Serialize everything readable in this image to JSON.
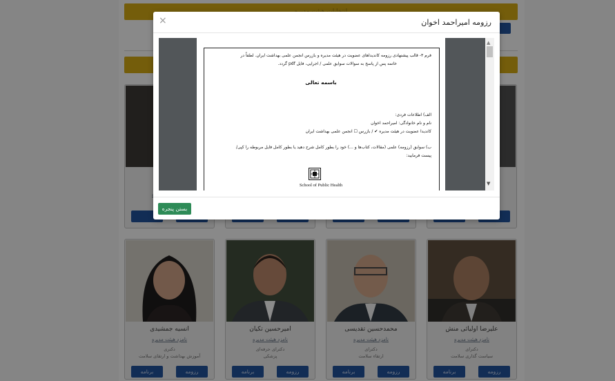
{
  "background": {
    "banner_top": "انتخابات هیئت مدیره",
    "cards_top": [
      {
        "role": "نامزد هیئت مدیره"
      },
      {
        "role": "نامزد هیئت مدیره"
      },
      {
        "role": "نامزد هیئت مدیره"
      },
      {
        "role": "نامزد هیئت مدیره"
      }
    ],
    "cards": [
      {
        "name": "علیرضا اولیائی منش",
        "role": "نامزد هیئت مدیره",
        "degree": "دکترای",
        "field": "سیاست گذاری سلامت",
        "resume": "رزومه",
        "program": "برنامه"
      },
      {
        "name": "محمدحسین تقدیسی",
        "role": "نامزد هیئت مدیره",
        "degree": "دکترای",
        "field": "ارتقاء سلامت",
        "resume": "رزومه",
        "program": "برنامه"
      },
      {
        "name": "امیرحسین تکیان",
        "role": "نامزد هیئت مدیره",
        "degree": "دکترای حرفه‌ای",
        "field": "پزشکی",
        "resume": "رزومه",
        "program": "برنامه"
      },
      {
        "name": "انسیه جمشیدی",
        "role": "نامزد هیئت مدیره",
        "degree": "دکتری",
        "field": "آموزش بهداشت و ارتقای سلامت",
        "resume": "رزومه",
        "program": "برنامه"
      }
    ]
  },
  "modal": {
    "title": "رزومه امیراحمد اخوان",
    "close_icon": "×",
    "close_button": "بستن پنجره",
    "document": {
      "line1": "فرم ۳- قالب پیشنهادی رزومه کاندیداهای عضویت در هیئت مدیره و بازرس انجمن علمی بهداشت ایران. لطفاً در",
      "line2": "خاتمه پس از پاسخ به سوالات سوابق علمی / اجرایی، فایل pdf گردد.",
      "heading": "باسمه تعالی",
      "section_a": "الف) اطلاعات فردی:",
      "full_name": "نام و نام خانوادگی: امیراحمد اخوان",
      "candidacy": "کاندیدا عضویت در هیئت مدیره  ✔  /  بازرس  ☐  انجمن علمی بهداشت ایران",
      "section_b": "ب) سوابق (رزومه) علمی (مقالات، کتاب‌ها و ...) خود را بطور کامل شرح دهید یا بطور کامل فایل مربوطه را کپی/",
      "section_b2": "پیست فرمایید:",
      "logo_caption": "School of Public Health"
    }
  },
  "colors": {
    "banner": "#c9a114",
    "button_blue": "#1f4e93",
    "close_green": "#2e8b57"
  }
}
